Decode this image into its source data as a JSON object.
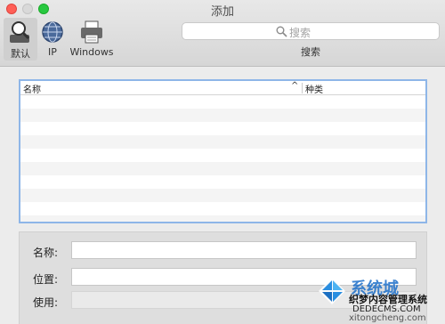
{
  "window": {
    "title": "添加"
  },
  "toolbar": {
    "buttons": [
      {
        "label": "默认",
        "icon": "default-printer-search-icon"
      },
      {
        "label": "IP",
        "icon": "globe-icon"
      },
      {
        "label": "Windows",
        "icon": "printer-icon"
      }
    ],
    "search": {
      "placeholder": "搜索",
      "label": "搜索",
      "icon": "search-icon"
    }
  },
  "list": {
    "columns": [
      {
        "label": "名称",
        "sort_indicator": "^"
      },
      {
        "label": "种类"
      }
    ],
    "rows": []
  },
  "form": {
    "name_label": "名称:",
    "location_label": "位置:",
    "use_label": "使用:",
    "name_value": "",
    "location_value": "",
    "use_value": ""
  },
  "watermark": {
    "title": "系统城",
    "subtitle": "织梦内容管理系统",
    "domain": "DEDECMS.COM",
    "url": "xitongcheng.com"
  },
  "colors": {
    "selection_border": "#8eb6e8",
    "close": "#ff5f57",
    "maximize": "#28c840"
  }
}
